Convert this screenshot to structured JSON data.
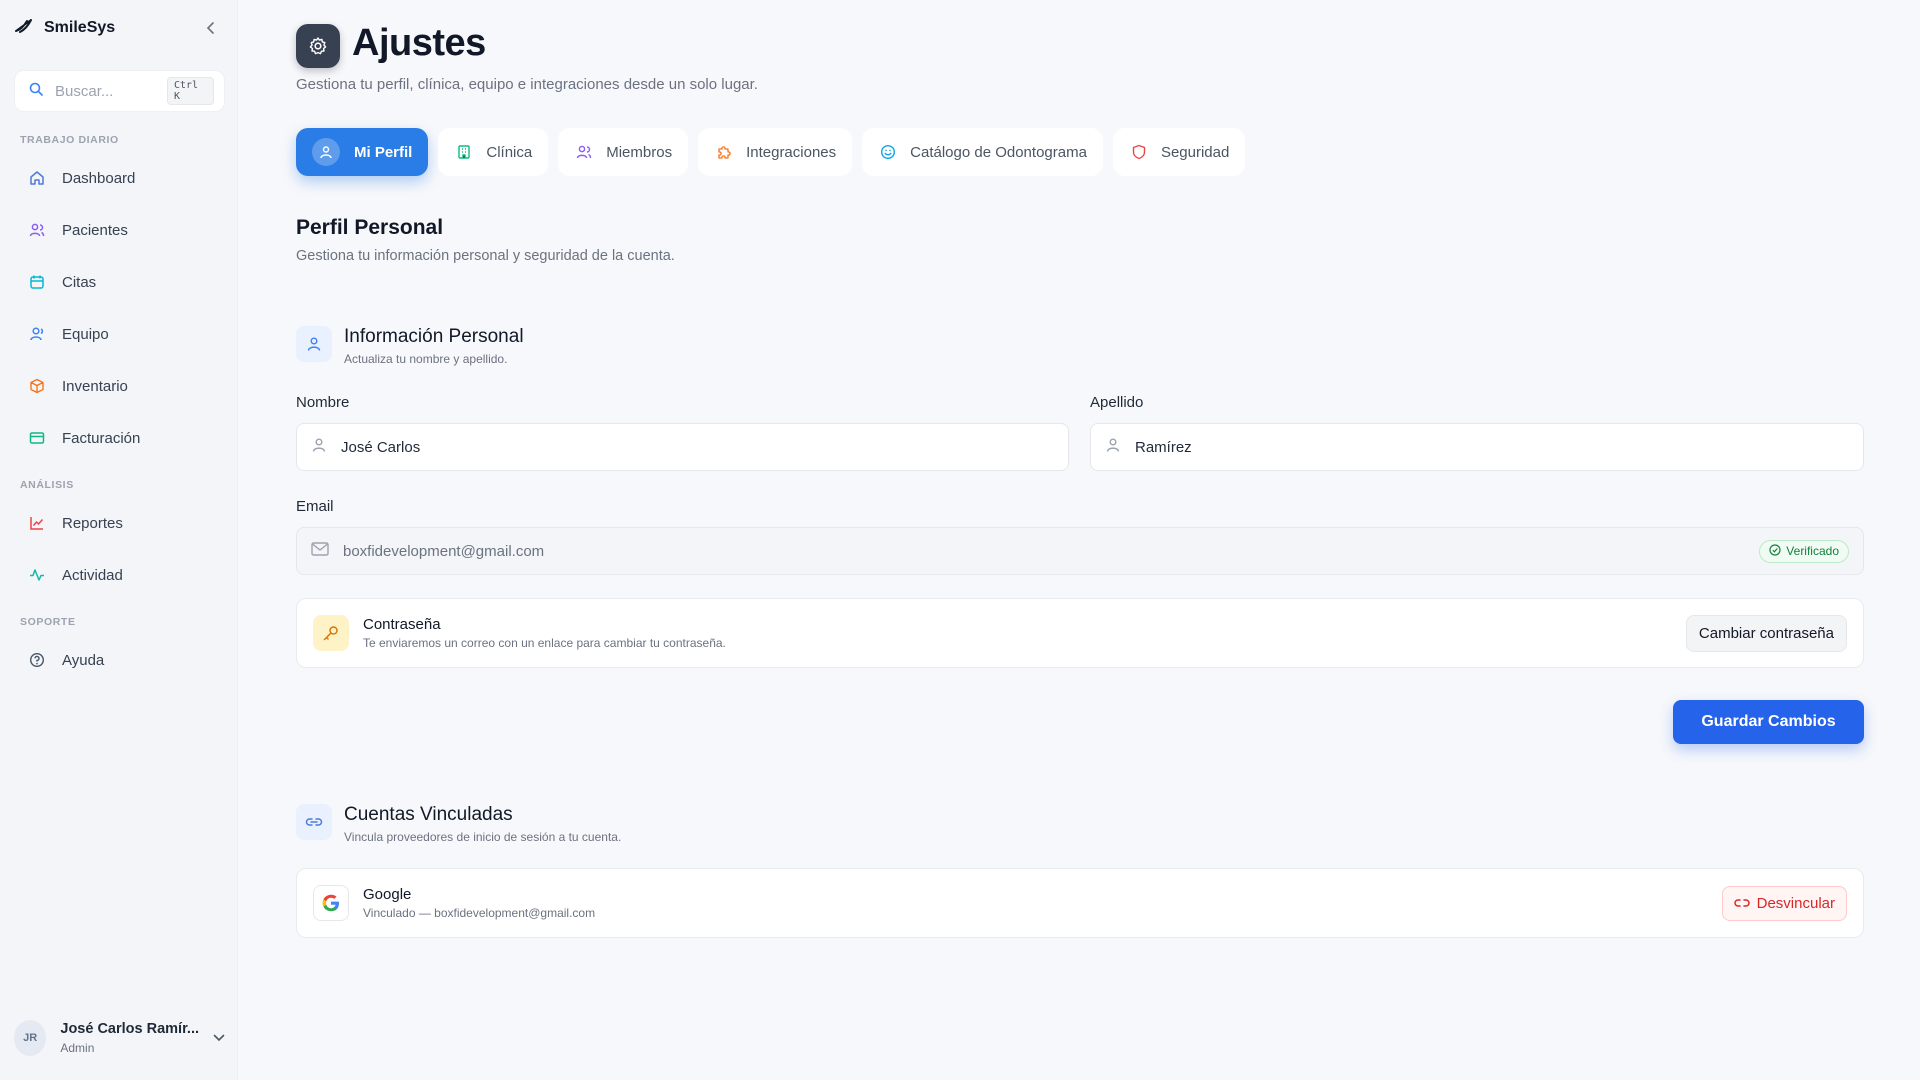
{
  "app": {
    "name": "SmileSys"
  },
  "search": {
    "placeholder": "Buscar...",
    "shortcut": "Ctrl K"
  },
  "sidebar": {
    "sections": [
      "TRABAJO DIARIO",
      "ANÁLISIS",
      "SOPORTE"
    ],
    "items": [
      {
        "label": "Dashboard",
        "icon": "home-icon",
        "color": "#4f7bd8"
      },
      {
        "label": "Pacientes",
        "icon": "users-icon",
        "color": "#8b5cf6"
      },
      {
        "label": "Citas",
        "icon": "calendar-icon",
        "color": "#06b6d4"
      },
      {
        "label": "Equipo",
        "icon": "user-group-icon",
        "color": "#3b82f6"
      },
      {
        "label": "Inventario",
        "icon": "box-icon",
        "color": "#f97316"
      },
      {
        "label": "Facturación",
        "icon": "credit-card-icon",
        "color": "#10b981"
      },
      {
        "label": "Reportes",
        "icon": "line-chart-icon",
        "color": "#ef4444"
      },
      {
        "label": "Actividad",
        "icon": "activity-icon",
        "color": "#14b8a6"
      },
      {
        "label": "Ayuda",
        "icon": "help-circle-icon",
        "color": "#64748b"
      }
    ],
    "user": {
      "initials": "JR",
      "name": "José Carlos Ramír...",
      "role": "Admin"
    }
  },
  "header": {
    "title": "Ajustes",
    "subtitle": "Gestiona tu perfil, clínica, equipo e integraciones desde un solo lugar."
  },
  "tabs": [
    {
      "label": "Mi Perfil",
      "icon": "user-icon",
      "active": true
    },
    {
      "label": "Clínica",
      "icon": "building-icon",
      "color": "#10b981"
    },
    {
      "label": "Miembros",
      "icon": "users-icon",
      "color": "#8b5cf6"
    },
    {
      "label": "Integraciones",
      "icon": "puzzle-icon",
      "color": "#f97316"
    },
    {
      "label": "Catálogo de Odontograma",
      "icon": "smile-icon",
      "color": "#0ea5e9"
    },
    {
      "label": "Seguridad",
      "icon": "shield-icon",
      "color": "#ef4444"
    }
  ],
  "profile": {
    "title": "Perfil Personal",
    "subtitle": "Gestiona tu información personal y seguridad de la cuenta.",
    "personal": {
      "title": "Información Personal",
      "subtitle": "Actualiza tu nombre y apellido.",
      "first_name_label": "Nombre",
      "first_name": "José Carlos",
      "last_name_label": "Apellido",
      "last_name": "Ramírez",
      "email_label": "Email",
      "email": "boxfidevelopment@gmail.com",
      "verified": "Verificado"
    },
    "password": {
      "title": "Contraseña",
      "subtitle": "Te enviaremos un correo con un enlace para cambiar tu contraseña.",
      "button": "Cambiar contraseña"
    },
    "save_button": "Guardar Cambios",
    "linked": {
      "title": "Cuentas Vinculadas",
      "subtitle": "Vincula proveedores de inicio de sesión a tu cuenta.",
      "provider": "Google",
      "detail": "Vinculado — boxfidevelopment@gmail.com",
      "button": "Desvincular"
    }
  },
  "colors": {
    "primary": "#2563eb",
    "tab_active": "#2a7de6",
    "verified": "#15803d",
    "danger": "#dc2626"
  }
}
